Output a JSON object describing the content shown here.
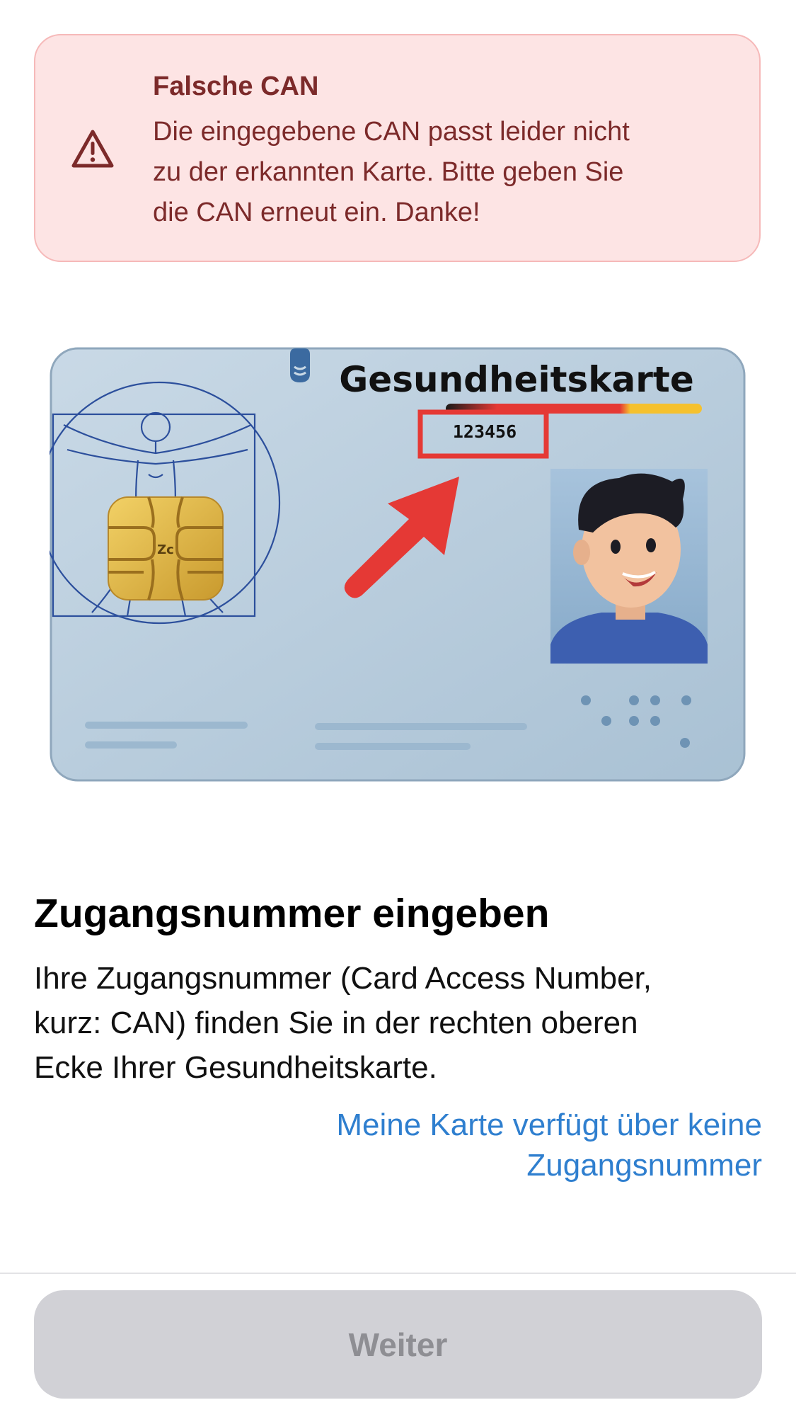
{
  "error_banner": {
    "icon": "warning-triangle-icon",
    "title": "Falsche CAN",
    "message_lines": [
      "Die eingegebene CAN passt leider nicht",
      "zu der erkannten Karte. Bitte geben Sie",
      "die CAN erneut ein. Danke!"
    ],
    "colors": {
      "background": "#fde4e4",
      "border": "#f6b9b9",
      "text": "#7c2a2a"
    }
  },
  "card_illustration": {
    "card_title": "Gesundheitskarte",
    "can_example": "123456",
    "highlight_color": "#e53935"
  },
  "heading": "Zugangsnummer eingeben",
  "body_lines": [
    "Ihre Zugangsnummer (Card Access Number,",
    "kurz: CAN) finden Sie in der rechten oberen",
    "Ecke Ihrer Gesundheitskarte."
  ],
  "no_can_link": {
    "lines": [
      "Meine Karte verfügt über keine",
      "Zugangsnummer"
    ],
    "color": "#2f7fcf"
  },
  "continue_button": {
    "label": "Weiter",
    "enabled": false
  }
}
